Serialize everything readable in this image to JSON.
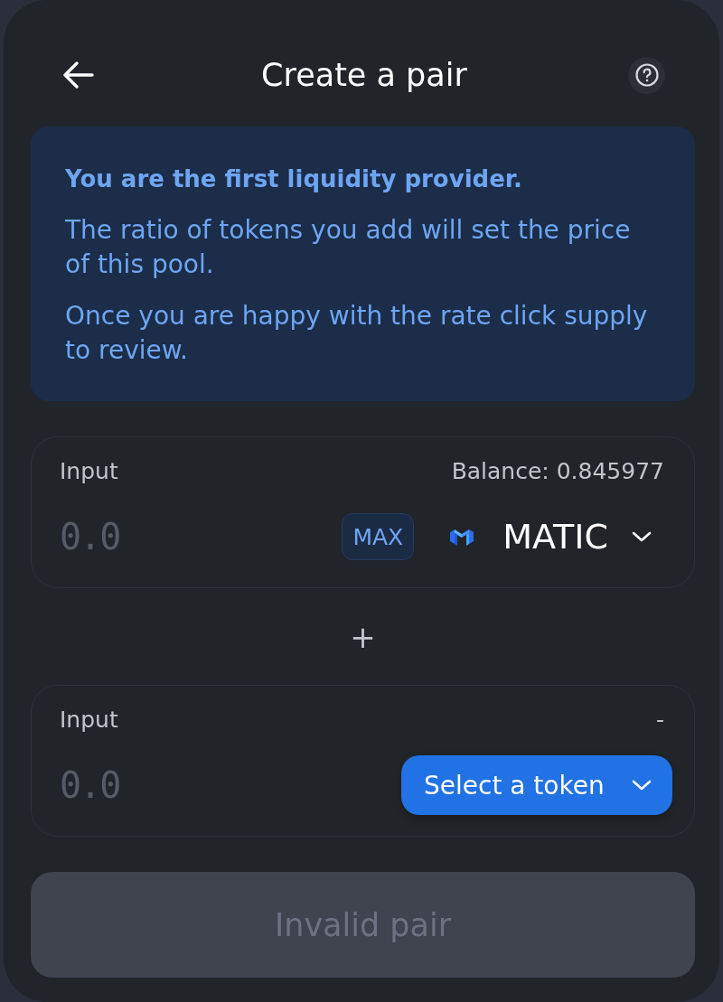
{
  "header": {
    "title": "Create a pair"
  },
  "notice": {
    "title": "You are the first liquidity provider.",
    "paragraphs": [
      "The ratio of tokens you add will set the price of this pool.",
      "Once you are happy with the rate click supply to review."
    ]
  },
  "pair_inputs": [
    {
      "label": "Input",
      "balance": "Balance: 0.845977",
      "placeholder": "0.0",
      "max_button": "MAX",
      "token": {
        "kind": "selected",
        "symbol": "MATIC"
      }
    },
    {
      "label": "Input",
      "balance": "-",
      "placeholder": "0.0",
      "token": {
        "kind": "select",
        "label": "Select a token"
      }
    }
  ],
  "separator": "+",
  "submit": {
    "label": "Invalid pair",
    "disabled": true
  }
}
